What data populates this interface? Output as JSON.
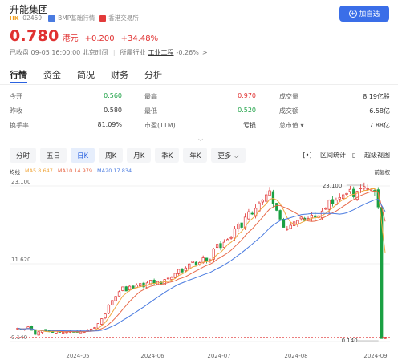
{
  "header": {
    "title": "升能集团",
    "market_tag": "HK",
    "code": "02459",
    "quote_source": "BMP基础行情",
    "exchange": "香港交易所",
    "watch_button": "加自选"
  },
  "quote": {
    "price": "0.780",
    "currency": "港元",
    "change": "+0.200",
    "change_pct": "+34.48%",
    "status": "已收盘 09-05 16:00:00 北京时间",
    "industry_prefix": "所属行业",
    "industry": "工业工程",
    "industry_change": "-0.26%",
    "industry_arrow": ">"
  },
  "tabs": [
    "行情",
    "资金",
    "简况",
    "财务",
    "分析"
  ],
  "stats": {
    "rows": [
      [
        {
          "label": "今开",
          "value": "0.560",
          "color": "green"
        },
        {
          "label": "最高",
          "value": "0.970",
          "color": "red"
        },
        {
          "label": "成交量",
          "value": "8.19亿股",
          "color": ""
        }
      ],
      [
        {
          "label": "昨收",
          "value": "0.580",
          "color": ""
        },
        {
          "label": "最低",
          "value": "0.520",
          "color": "green"
        },
        {
          "label": "成交额",
          "value": "6.58亿",
          "color": ""
        }
      ],
      [
        {
          "label": "换手率",
          "value": "81.09%",
          "color": ""
        },
        {
          "label": "市盈(TTM)",
          "value": "亏损",
          "color": ""
        },
        {
          "label": "总市值 ▾",
          "value": "7.88亿",
          "color": ""
        }
      ]
    ],
    "expand_icon": "chevron-down-icon"
  },
  "periods": {
    "items": [
      "分时",
      "五日",
      "日K",
      "周K",
      "月K",
      "季K",
      "年K",
      "更多"
    ],
    "active": "日K",
    "more_arrow": "⌵",
    "interval_stats": "区间统计",
    "super_view": "超级视图",
    "adjust": "前复权"
  },
  "ma": {
    "title": "均线",
    "items": [
      {
        "label": "MA5 8.647",
        "color": "#f0a840"
      },
      {
        "label": "MA10 14.979",
        "color": "#e86a4a"
      },
      {
        "label": "MA20 17.834",
        "color": "#4a7be0"
      }
    ]
  },
  "chart_data": {
    "type": "candlestick",
    "y_axis_labels": [
      "23.100",
      "11.620",
      "0.140"
    ],
    "x_axis_labels": [
      "2024-05",
      "2024-06",
      "2024-07",
      "2024-08",
      "2024-09"
    ],
    "ylim": [
      0.14,
      23.1
    ],
    "high_marker": "23.100",
    "low_marker": "0.140",
    "colors": {
      "up": "#e03131",
      "down": "#1aa043",
      "ma5": "#f0a840",
      "ma10": "#e86a4a",
      "ma20": "#4a7be0"
    },
    "close_trend": [
      2.1,
      1.9,
      2.0,
      2.3,
      1.8,
      1.2,
      1.6,
      1.8,
      1.7,
      1.6,
      1.5,
      1.7,
      1.6,
      1.5,
      1.6,
      1.7,
      1.6,
      1.5,
      1.7,
      1.6,
      1.8,
      2.0,
      2.2,
      2.8,
      3.5,
      4.2,
      5.5,
      6.2,
      6.8,
      7.5,
      8.2,
      7.6,
      8.3,
      8.0,
      8.5,
      8.7,
      8.2,
      8.8,
      9.2,
      8.7,
      9.0,
      8.6,
      9.3,
      9.5,
      9.6,
      10.2,
      10.8,
      10.4,
      11.0,
      11.6,
      12.0,
      11.4,
      11.8,
      12.5,
      12.0,
      12.2,
      13.8,
      14.5,
      14.0,
      14.8,
      15.2,
      15.5,
      16.8,
      17.5,
      17.0,
      18.5,
      19.3,
      19.0,
      19.8,
      20.6,
      21.0,
      21.8,
      22.4,
      20.5,
      19.5,
      18.2,
      17.0,
      16.8,
      17.3,
      17.8,
      18.0,
      18.5,
      18.0,
      18.3,
      18.8,
      18.5,
      18.7,
      19.4,
      19.8,
      21.0,
      20.5,
      21.0,
      21.4,
      21.8,
      22.0,
      22.6,
      21.5,
      22.3,
      22.8,
      23.0,
      22.7,
      22.6,
      22.3,
      20.0,
      0.58,
      0.78
    ]
  }
}
